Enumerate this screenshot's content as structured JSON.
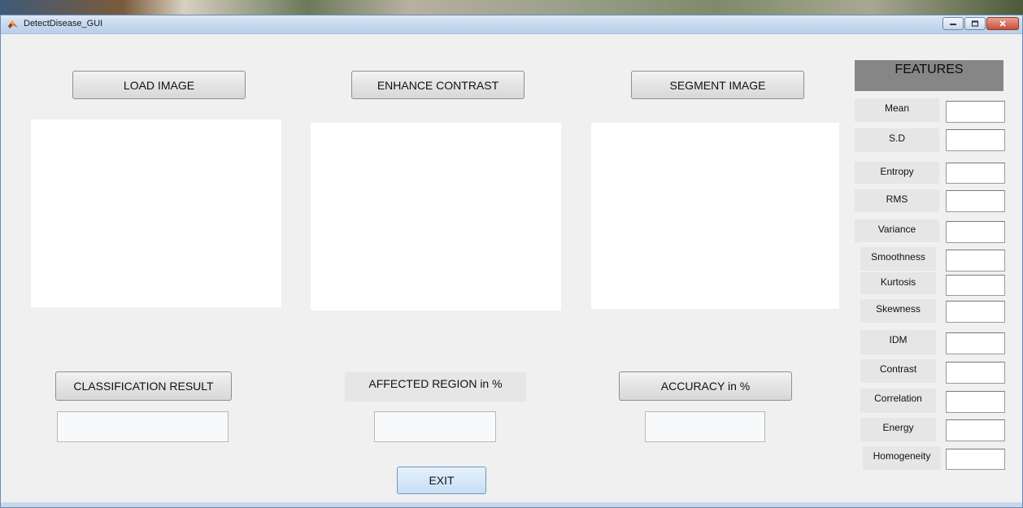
{
  "window": {
    "title": "DetectDisease_GUI"
  },
  "buttons": {
    "load_image": "LOAD IMAGE",
    "enhance_contrast": "ENHANCE CONTRAST",
    "segment_image": "SEGMENT IMAGE",
    "classification_result": "CLASSIFICATION RESULT",
    "accuracy": "ACCURACY in %",
    "exit": "EXIT"
  },
  "labels": {
    "affected_region": "AFFECTED REGION in %"
  },
  "features": {
    "header": "FEATURES",
    "items": [
      {
        "label": "Mean",
        "value": ""
      },
      {
        "label": "S.D",
        "value": ""
      },
      {
        "label": "Entropy",
        "value": ""
      },
      {
        "label": "RMS",
        "value": ""
      },
      {
        "label": "Variance",
        "value": ""
      },
      {
        "label": "Smoothness",
        "value": ""
      },
      {
        "label": "Kurtosis",
        "value": ""
      },
      {
        "label": "Skewness",
        "value": ""
      },
      {
        "label": "IDM",
        "value": ""
      },
      {
        "label": "Contrast",
        "value": ""
      },
      {
        "label": "Correlation",
        "value": ""
      },
      {
        "label": "Energy",
        "value": ""
      },
      {
        "label": "Homogeneity",
        "value": ""
      }
    ]
  },
  "results": {
    "classification_value": "",
    "affected_region_value": "",
    "accuracy_value": ""
  },
  "colors": {
    "window_bg": "#f0f0f0",
    "features_header_bg": "#868686",
    "label_bg": "#e6e6e6",
    "exit_button_bg": "#d6e8f8"
  }
}
